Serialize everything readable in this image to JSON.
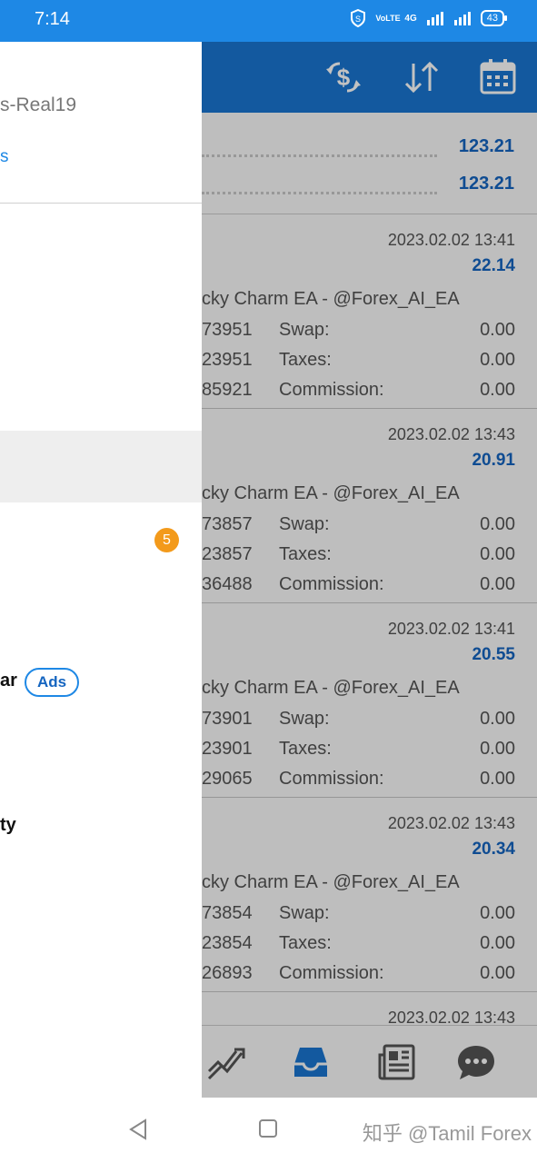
{
  "status_bar": {
    "time": "7:14",
    "network": "4G",
    "carrier_label": "VoLTE",
    "battery": "43"
  },
  "drawer": {
    "account_name": "s-Real19",
    "account_link": "s",
    "badge_count": "5",
    "menu_item_ar": "ar",
    "ads_label": "Ads",
    "menu_item_ty": "ty"
  },
  "history": {
    "summary": [
      "123.21",
      "123.21"
    ],
    "deals": [
      {
        "date": "2023.02.02 13:41",
        "profit": "22.14",
        "comment": "cky Charm EA - @Forex_AI_EA",
        "ids": [
          "73951",
          "23951",
          "85921"
        ],
        "swap": "0.00",
        "taxes": "0.00",
        "commission": "0.00"
      },
      {
        "date": "2023.02.02 13:43",
        "profit": "20.91",
        "comment": "cky Charm EA - @Forex_AI_EA",
        "ids": [
          "73857",
          "23857",
          "36488"
        ],
        "swap": "0.00",
        "taxes": "0.00",
        "commission": "0.00"
      },
      {
        "date": "2023.02.02 13:41",
        "profit": "20.55",
        "comment": "cky Charm EA - @Forex_AI_EA",
        "ids": [
          "73901",
          "23901",
          "29065"
        ],
        "swap": "0.00",
        "taxes": "0.00",
        "commission": "0.00"
      },
      {
        "date": "2023.02.02 13:43",
        "profit": "20.34",
        "comment": "cky Charm EA - @Forex_AI_EA",
        "ids": [
          "73854",
          "23854",
          "26893"
        ],
        "swap": "0.00",
        "taxes": "0.00",
        "commission": "0.00"
      },
      {
        "date": "2023.02.02 13:43"
      }
    ],
    "labels": {
      "swap": "Swap:",
      "taxes": "Taxes:",
      "commission": "Commission:"
    }
  },
  "toolbar_icons": [
    "currency-exchange-icon",
    "sort-icon",
    "calendar-icon"
  ],
  "bottom_nav_icons": [
    "trade-chart-icon",
    "history-inbox-icon",
    "news-icon",
    "chat-icon"
  ],
  "watermark": "知乎 @Tamil Forex",
  "colors": {
    "accent": "#1976d2",
    "value_blue": "#1565c0",
    "badge_orange": "#f39a1b"
  }
}
